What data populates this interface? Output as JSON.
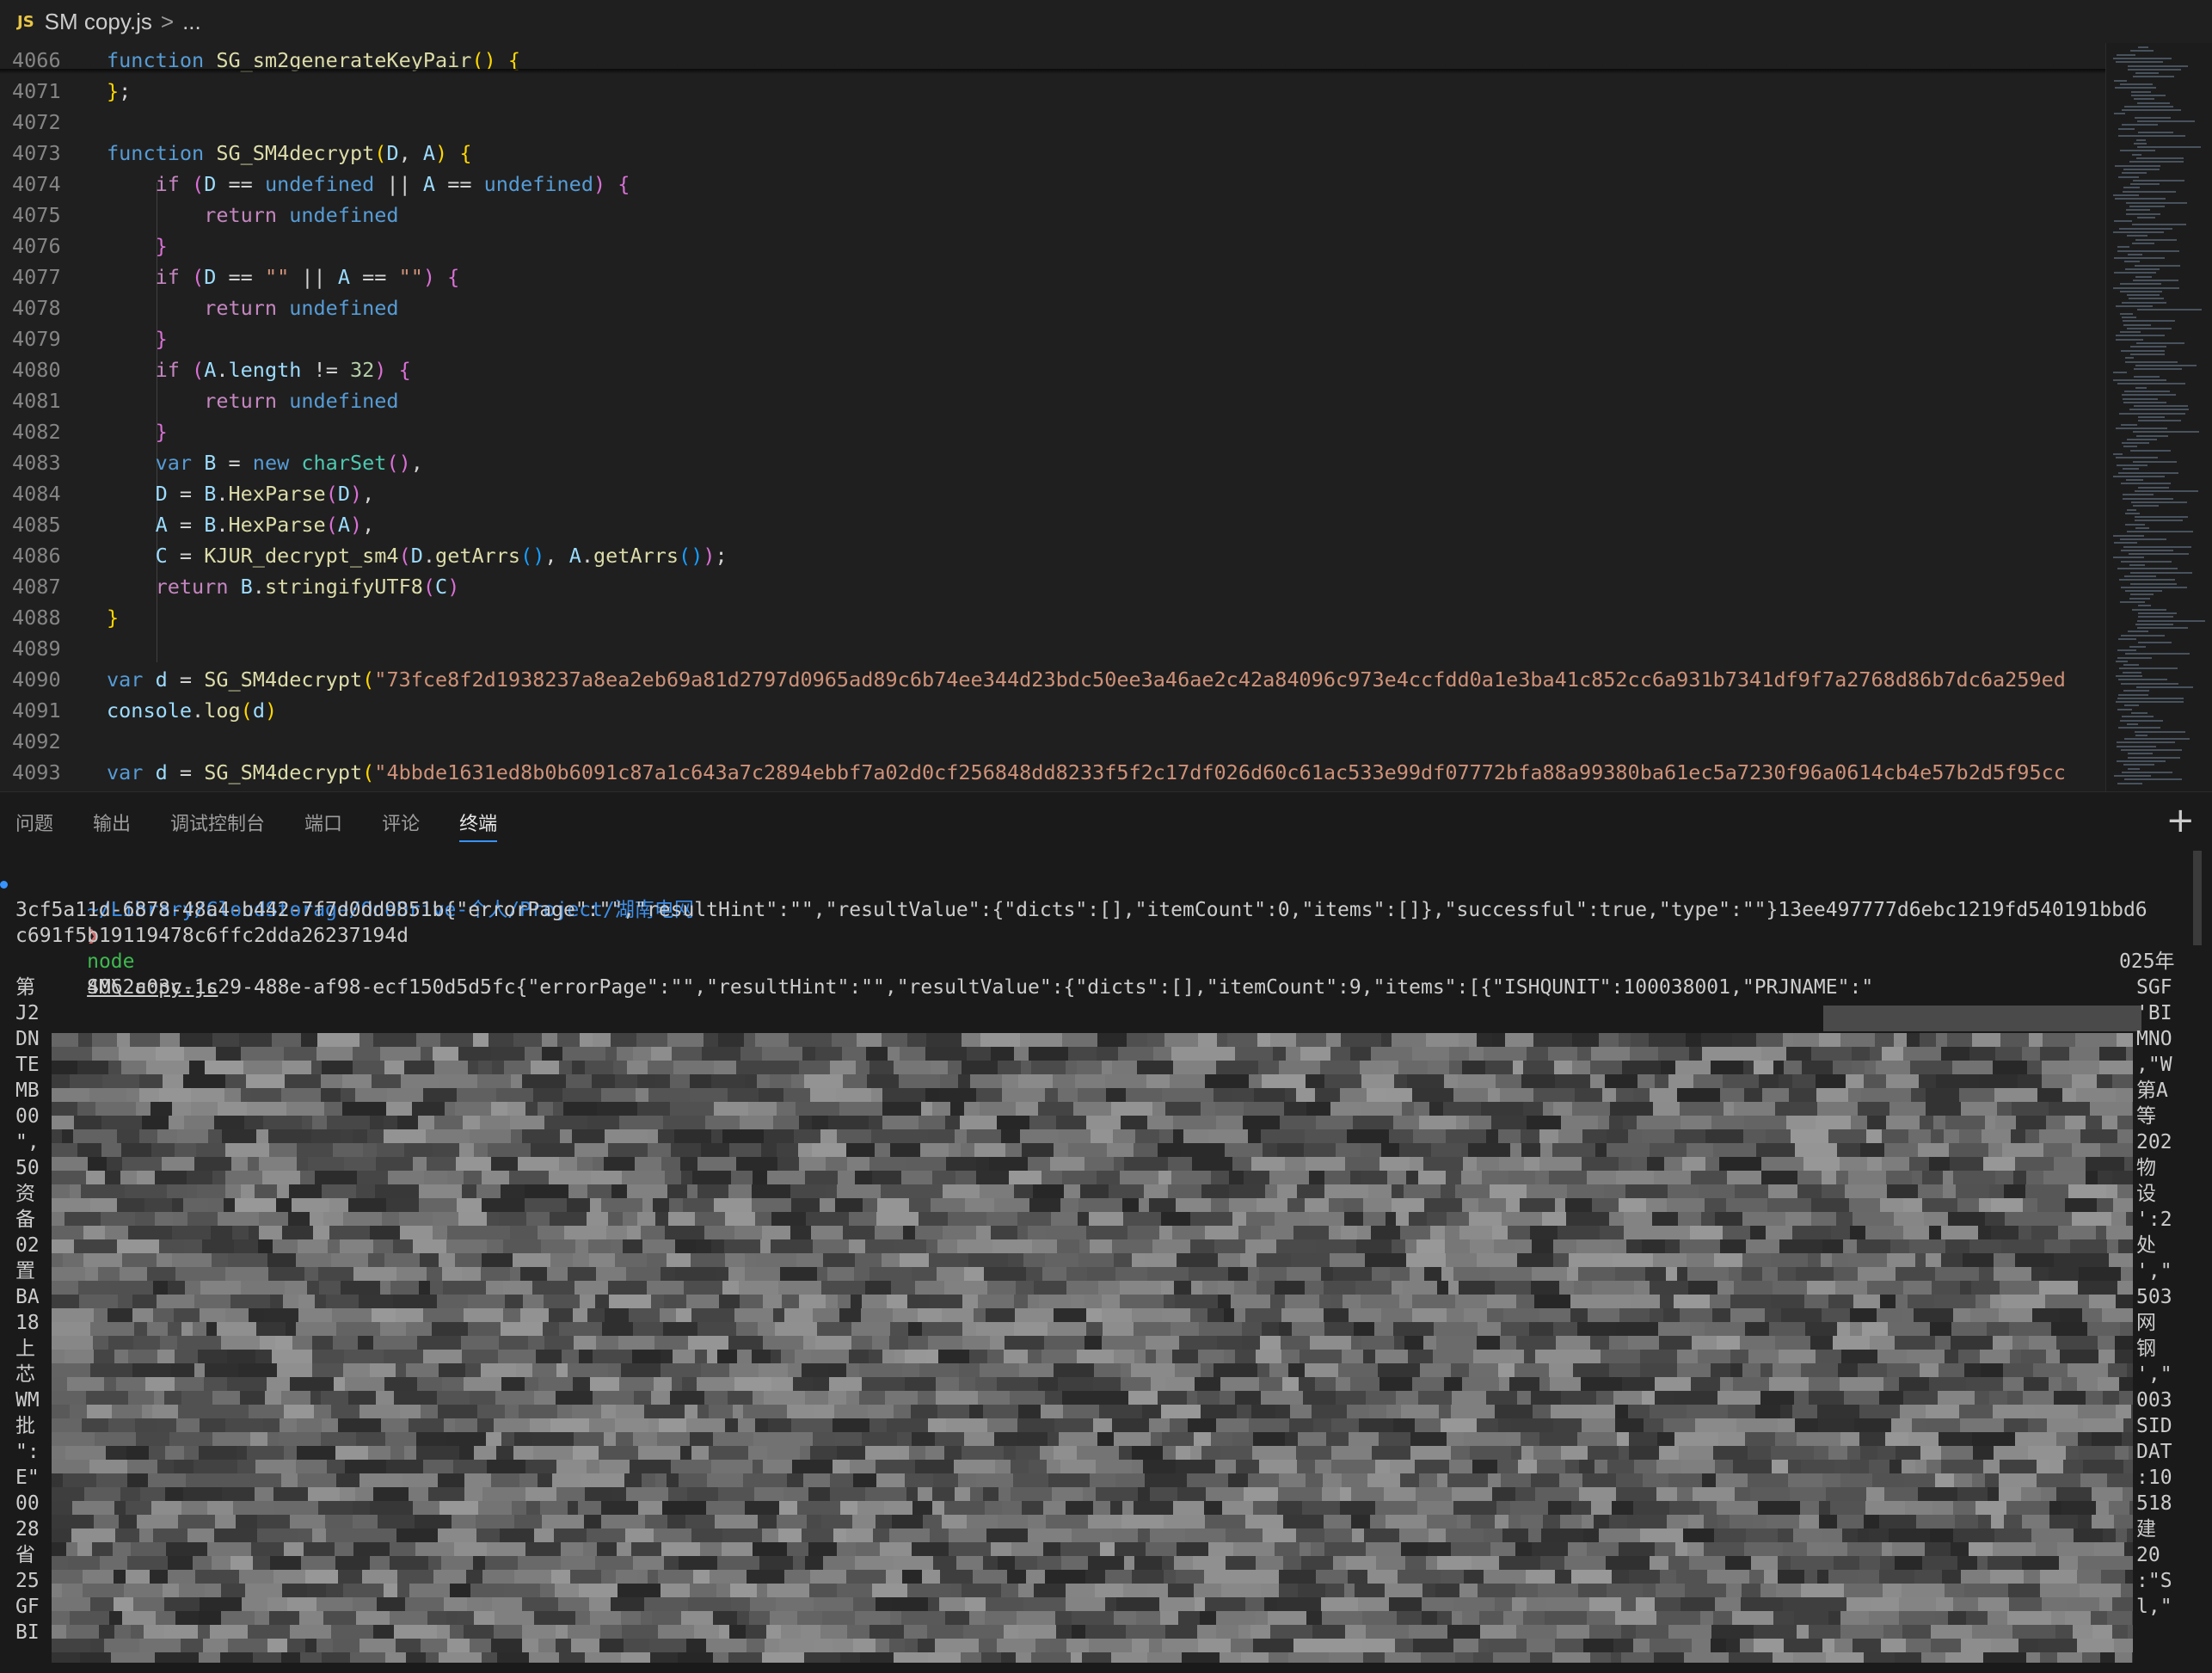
{
  "breadcrumb": {
    "lang_badge": "JS",
    "file": "SM copy.js",
    "sep": ">",
    "more": "..."
  },
  "editor": {
    "lines": [
      {
        "n": "4066",
        "tokens": [
          [
            "kw",
            "function "
          ],
          [
            "fn",
            "SG_sm2generateKeyPair"
          ],
          [
            "p1",
            "() {"
          ]
        ]
      },
      {
        "n": "4071",
        "tokens": [
          [
            "p1",
            "}"
          ],
          [
            "white",
            ";"
          ]
        ]
      },
      {
        "n": "4072",
        "tokens": []
      },
      {
        "n": "4073",
        "tokens": [
          [
            "kw",
            "function "
          ],
          [
            "fn",
            "SG_SM4decrypt"
          ],
          [
            "p1",
            "("
          ],
          [
            "var",
            "D"
          ],
          [
            "white",
            ", "
          ],
          [
            "var",
            "A"
          ],
          [
            "p1",
            ") {"
          ]
        ]
      },
      {
        "n": "4074",
        "tokens": [
          [
            "white",
            "    "
          ],
          [
            "ctl",
            "if "
          ],
          [
            "p2",
            "("
          ],
          [
            "var",
            "D"
          ],
          [
            "white",
            " == "
          ],
          [
            "kw",
            "undefined"
          ],
          [
            "white",
            " || "
          ],
          [
            "var",
            "A"
          ],
          [
            "white",
            " == "
          ],
          [
            "kw",
            "undefined"
          ],
          [
            "p2",
            ") {"
          ]
        ]
      },
      {
        "n": "4075",
        "tokens": [
          [
            "white",
            "        "
          ],
          [
            "ctl",
            "return "
          ],
          [
            "kw",
            "undefined"
          ]
        ]
      },
      {
        "n": "4076",
        "tokens": [
          [
            "white",
            "    "
          ],
          [
            "p2",
            "}"
          ]
        ]
      },
      {
        "n": "4077",
        "tokens": [
          [
            "white",
            "    "
          ],
          [
            "ctl",
            "if "
          ],
          [
            "p2",
            "("
          ],
          [
            "var",
            "D"
          ],
          [
            "white",
            " == "
          ],
          [
            "str",
            "\"\""
          ],
          [
            "white",
            " || "
          ],
          [
            "var",
            "A"
          ],
          [
            "white",
            " == "
          ],
          [
            "str",
            "\"\""
          ],
          [
            "p2",
            ") {"
          ]
        ]
      },
      {
        "n": "4078",
        "tokens": [
          [
            "white",
            "        "
          ],
          [
            "ctl",
            "return "
          ],
          [
            "kw",
            "undefined"
          ]
        ]
      },
      {
        "n": "4079",
        "tokens": [
          [
            "white",
            "    "
          ],
          [
            "p2",
            "}"
          ]
        ]
      },
      {
        "n": "4080",
        "tokens": [
          [
            "white",
            "    "
          ],
          [
            "ctl",
            "if "
          ],
          [
            "p2",
            "("
          ],
          [
            "var",
            "A"
          ],
          [
            "white",
            "."
          ],
          [
            "var",
            "length"
          ],
          [
            "white",
            " != "
          ],
          [
            "num",
            "32"
          ],
          [
            "p2",
            ") {"
          ]
        ]
      },
      {
        "n": "4081",
        "tokens": [
          [
            "white",
            "        "
          ],
          [
            "ctl",
            "return "
          ],
          [
            "kw",
            "undefined"
          ]
        ]
      },
      {
        "n": "4082",
        "tokens": [
          [
            "white",
            "    "
          ],
          [
            "p2",
            "}"
          ]
        ]
      },
      {
        "n": "4083",
        "tokens": [
          [
            "white",
            "    "
          ],
          [
            "kw",
            "var "
          ],
          [
            "var",
            "B"
          ],
          [
            "white",
            " = "
          ],
          [
            "kw",
            "new "
          ],
          [
            "cls",
            "charSet"
          ],
          [
            "p2",
            "()"
          ],
          [
            "white",
            ","
          ]
        ]
      },
      {
        "n": "4084",
        "tokens": [
          [
            "white",
            "    "
          ],
          [
            "var",
            "D"
          ],
          [
            "white",
            " = "
          ],
          [
            "var",
            "B"
          ],
          [
            "white",
            "."
          ],
          [
            "fn",
            "HexParse"
          ],
          [
            "p2",
            "("
          ],
          [
            "var",
            "D"
          ],
          [
            "p2",
            ")"
          ],
          [
            "white",
            ","
          ]
        ]
      },
      {
        "n": "4085",
        "tokens": [
          [
            "white",
            "    "
          ],
          [
            "var",
            "A"
          ],
          [
            "white",
            " = "
          ],
          [
            "var",
            "B"
          ],
          [
            "white",
            "."
          ],
          [
            "fn",
            "HexParse"
          ],
          [
            "p2",
            "("
          ],
          [
            "var",
            "A"
          ],
          [
            "p2",
            ")"
          ],
          [
            "white",
            ","
          ]
        ]
      },
      {
        "n": "4086",
        "tokens": [
          [
            "white",
            "    "
          ],
          [
            "var",
            "C"
          ],
          [
            "white",
            " = "
          ],
          [
            "fn",
            "KJUR_decrypt_sm4"
          ],
          [
            "p2",
            "("
          ],
          [
            "var",
            "D"
          ],
          [
            "white",
            "."
          ],
          [
            "fn",
            "getArrs"
          ],
          [
            "p3",
            "()"
          ],
          [
            "white",
            ", "
          ],
          [
            "var",
            "A"
          ],
          [
            "white",
            "."
          ],
          [
            "fn",
            "getArrs"
          ],
          [
            "p3",
            "()"
          ],
          [
            "p2",
            ")"
          ],
          [
            "white",
            ";"
          ]
        ]
      },
      {
        "n": "4087",
        "tokens": [
          [
            "white",
            "    "
          ],
          [
            "ctl",
            "return "
          ],
          [
            "var",
            "B"
          ],
          [
            "white",
            "."
          ],
          [
            "fn",
            "stringifyUTF8"
          ],
          [
            "p2",
            "("
          ],
          [
            "var",
            "C"
          ],
          [
            "p2",
            ")"
          ]
        ]
      },
      {
        "n": "4088",
        "tokens": [
          [
            "p1",
            "}"
          ]
        ]
      },
      {
        "n": "4089",
        "tokens": []
      },
      {
        "n": "4090",
        "tokens": [
          [
            "kw",
            "var "
          ],
          [
            "var",
            "d"
          ],
          [
            "white",
            " = "
          ],
          [
            "fn",
            "SG_SM4decrypt"
          ],
          [
            "p1",
            "("
          ],
          [
            "str",
            "\"73fce8f2d1938237a8ea2eb69a81d2797d0965ad89c6b74ee344d23bdc50ee3a46ae2c42a84096c973e4ccfdd0a1e3ba41c852cc6a931b7341df9f7a2768d86b7dc6a259ed"
          ]
        ]
      },
      {
        "n": "4091",
        "tokens": [
          [
            "var",
            "console"
          ],
          [
            "white",
            "."
          ],
          [
            "fn",
            "log"
          ],
          [
            "p1",
            "("
          ],
          [
            "var",
            "d"
          ],
          [
            "p1",
            ")"
          ]
        ]
      },
      {
        "n": "4092",
        "tokens": []
      },
      {
        "n": "4093",
        "tokens": [
          [
            "kw",
            "var "
          ],
          [
            "var",
            "d"
          ],
          [
            "white",
            " = "
          ],
          [
            "fn",
            "SG_SM4decrypt"
          ],
          [
            "p1",
            "("
          ],
          [
            "str",
            "\"4bbde1631ed8b0b6091c87a1c643a7c2894ebbf7a02d0cf256848dd8233f5f2c17df026d60c61ac533e99df07772bfa88a99380ba61ec5a7230f96a0614cb4e57b2d5f95cc"
          ]
        ]
      }
    ]
  },
  "panel": {
    "tabs": [
      {
        "label": "问题",
        "active": false
      },
      {
        "label": "输出",
        "active": false
      },
      {
        "label": "调试控制台",
        "active": false
      },
      {
        "label": "端口",
        "active": false
      },
      {
        "label": "评论",
        "active": false
      },
      {
        "label": "终端",
        "active": true
      }
    ],
    "plus": "+"
  },
  "terminal": {
    "prompt_path": "~/Library/CloudStorage/OneDrive-个人/Project/湖南电网",
    "prompt_arrow": "❯",
    "cmd": "node",
    "cmd_arg": "SM\\ copy.js",
    "out1": "3cf5a11d-6878-48a4-b442-7f7d0dd9851b{\"errorPage\":\"\",\"resultHint\":\"\",\"resultValue\":{\"dicts\":[],\"itemCount\":0,\"items\":[]},\"successful\":true,\"type\":\"\"}13ee497777d6ebc1219fd540191bbd6",
    "out2": "c691f5b19119478c6ffc2dda26237194d",
    "out3": "4062a03c-1c29-488e-af98-ecf150d5d5fc{\"errorPage\":\"\",\"resultHint\":\"\",\"resultValue\":{\"dicts\":[],\"itemCount\":9,\"items\":[{\"ISHQUNIT\":100038001,\"PRJNAME\":\"",
    "out3_tail": "025年",
    "left_fragments": [
      "第",
      "J2",
      "DN",
      "TE",
      "MB",
      "00",
      "\",",
      "50",
      "资",
      "备",
      "02",
      "置",
      "BA",
      "18",
      "上",
      "芯",
      "WM",
      "批",
      "\":",
      "E\"",
      "00",
      "28",
      "省",
      "25",
      "GF",
      "BI"
    ],
    "right_fragments": [
      "SGF",
      "'BI",
      "MNO",
      ",\"W",
      "第A",
      "等",
      "202",
      "物",
      "设",
      "':2",
      "处",
      "',\"",
      "503",
      "网",
      "钢",
      "',\"",
      "003",
      "SID",
      "DAT",
      ":10",
      "518",
      "建",
      "20",
      ":\"S",
      "l,\""
    ]
  }
}
